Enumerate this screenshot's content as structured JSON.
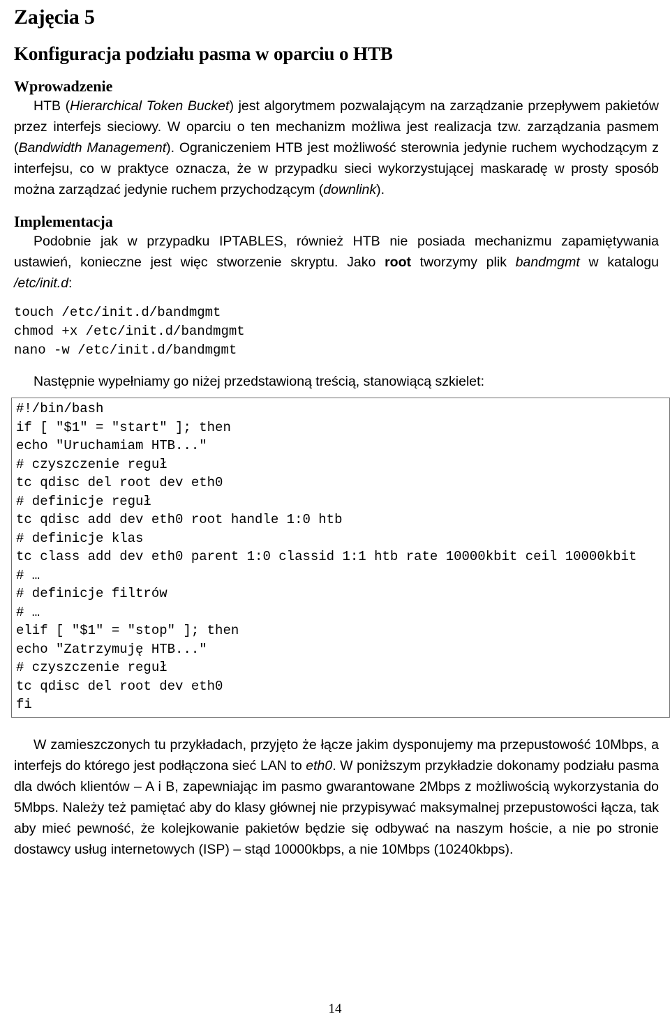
{
  "document": {
    "lesson_heading": "Zajęcia 5",
    "title": "Konfiguracja podziału pasma  w oparciu o HTB",
    "page_number": "14"
  },
  "sections": {
    "intro": {
      "heading": "Wprowadzenie",
      "paragraph_parts": {
        "p1_a": "HTB (",
        "p1_italic1": "Hierarchical Token Bucket",
        "p1_b": ") jest algorytmem pozwalającym na zarządzanie przepływem pakietów przez interfejs sieciowy. W oparciu o ten mechanizm możliwa jest realizacja tzw. zarządzania pasmem (",
        "p1_italic2": "Bandwidth Management",
        "p1_c": "). Ograniczeniem HTB jest możliwość sterownia jedynie ruchem wychodzącym z interfejsu, co w praktyce oznacza, że w przypadku sieci wykorzystującej maskaradę w prosty sposób można zarządzać jedynie ruchem przychodzącym (",
        "p1_italic3": "downlink",
        "p1_d": ")."
      }
    },
    "implementation": {
      "heading": "Implementacja",
      "paragraph_parts": {
        "p_a": "Podobnie jak w przypadku IPTABLES, również HTB nie posiada mechanizmu zapamiętywania ustawień, konieczne jest więc stworzenie skryptu. Jako ",
        "p_bold": "root",
        "p_b": " tworzymy plik ",
        "p_italic1": "bandmgmt",
        "p_c": " w katalogu ",
        "p_italic2": "/etc/init.d",
        "p_d": ":"
      },
      "commands": "touch /etc/init.d/bandmgmt\nchmod +x /etc/init.d/bandmgmt\nnano -w /etc/init.d/bandmgmt",
      "script_intro": "Następnie wypełniamy go niżej przedstawioną treścią, stanowiącą szkielet:",
      "script": "#!/bin/bash\nif [ \"$1\" = \"start\" ]; then\necho \"Uruchamiam HTB...\"\n# czyszczenie reguł\ntc qdisc del root dev eth0\n# definicje reguł\ntc qdisc add dev eth0 root handle 1:0 htb\n# definicje klas\ntc class add dev eth0 parent 1:0 classid 1:1 htb rate 10000kbit ceil 10000kbit\n# …\n# definicje filtrów\n# …\nelif [ \"$1\" = \"stop\" ]; then\necho \"Zatrzymuję HTB...\"\n# czyszczenie reguł\ntc qdisc del root dev eth0\nfi"
    },
    "notes": {
      "paragraph_parts": {
        "n_a": "W zamieszczonych tu przykładach, przyjęto że łącze jakim dysponujemy ma przepustowość 10Mbps, a interfejs do którego jest podłączona sieć LAN to ",
        "n_italic": "eth0",
        "n_b": ". W poniższym przykładzie dokonamy podziału pasma dla dwóch klientów – A i B, zapewniając im pasmo gwarantowane 2Mbps z możliwością wykorzystania do 5Mbps. Należy też pamiętać aby do klasy głównej nie przypisywać maksymalnej przepustowości łącza, tak aby mieć pewność, że kolejkowanie pakietów będzie się odbywać na naszym hoście, a nie po stronie dostawcy usług internetowych (ISP) – stąd 10000kbps, a nie 10Mbps (10240kbps)."
      }
    }
  },
  "colors": {
    "text": "#000000",
    "code_border": "#6e6e6e",
    "background": "#ffffff"
  }
}
